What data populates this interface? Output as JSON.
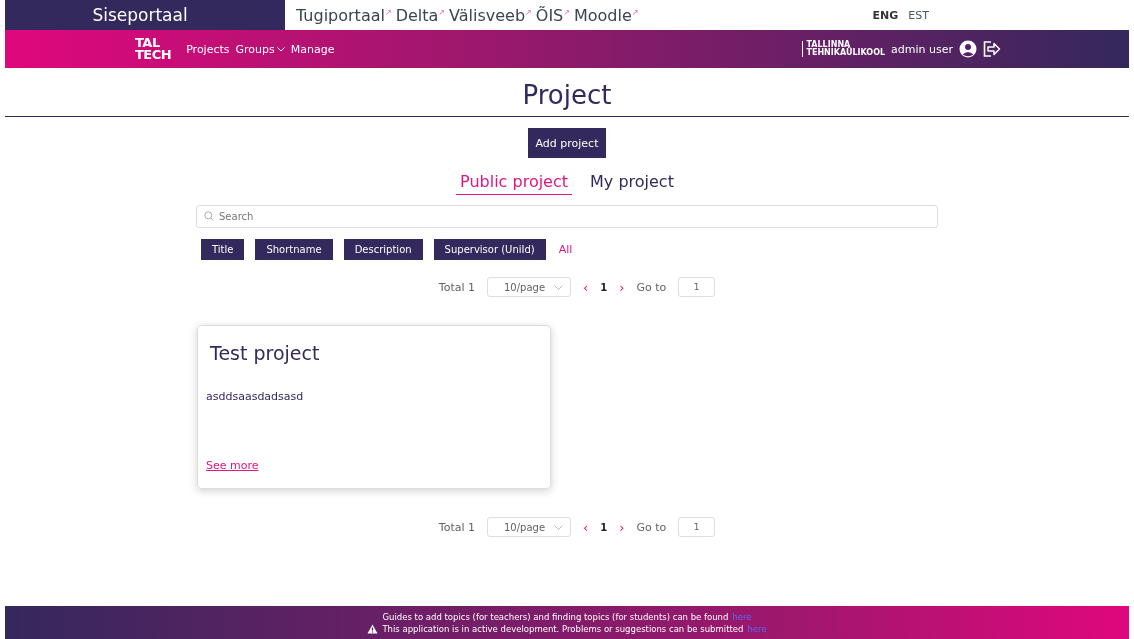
{
  "top_bar": {
    "portal_title": "Siseportaal",
    "links": [
      {
        "label": "Tugiportaal",
        "arrow": "↗"
      },
      {
        "label": "Delta",
        "arrow": "↗"
      },
      {
        "label": "Välisveeb",
        "arrow": "↗"
      },
      {
        "label": "ÕIS",
        "arrow": "↗"
      },
      {
        "label": "Moodle",
        "arrow": "↗"
      }
    ],
    "languages": [
      {
        "label": "ENG",
        "selected": true
      },
      {
        "label": "EST",
        "selected": false
      }
    ]
  },
  "nav": {
    "logo": [
      "TAL",
      "TECH"
    ],
    "items": [
      {
        "label": "Projects",
        "kind": "link"
      },
      {
        "label": "Groups",
        "kind": "dropdown"
      },
      {
        "label": "Manage",
        "kind": "link"
      }
    ],
    "university": [
      "TALLINNA",
      "TEHNIKAÜLIKOOL"
    ],
    "user": "admin user"
  },
  "page_title": "Project",
  "add_button": "Add project",
  "tabs": [
    {
      "label": "Public project",
      "selected": true
    },
    {
      "label": "My project",
      "selected": false
    }
  ],
  "search": {
    "placeholder": "Search"
  },
  "filters": [
    {
      "label": "Title",
      "kind": "button"
    },
    {
      "label": "Shortname",
      "kind": "button"
    },
    {
      "label": "Description",
      "kind": "button"
    },
    {
      "label": "Supervisor (UniId)",
      "kind": "button"
    },
    {
      "label": "All",
      "kind": "link"
    }
  ],
  "pagination_top": {
    "total": "Total 1",
    "page_size": "10/page",
    "prev": "‹",
    "pages": [
      {
        "label": "1",
        "selected": true
      }
    ],
    "next": "›",
    "goto_label": "Go to",
    "goto_value": "1"
  },
  "projects": [
    {
      "title": "Test project",
      "description": "asddsaasdadsasd",
      "link": "See more"
    }
  ],
  "pagination_bottom": {
    "total": "Total 1",
    "page_size": "10/page",
    "prev": "‹",
    "pages": [
      {
        "label": "1",
        "selected": true
      }
    ],
    "next": "›",
    "goto_label": "Go to",
    "goto_value": "1"
  },
  "footer": [
    {
      "text": "Guides to add topics (for teachers) and finding topics (for students) can be found",
      "link": "here",
      "warning": false
    },
    {
      "text": "This application is in active development. Problems or suggestions can be submitted",
      "link": "here",
      "warning": true
    }
  ]
}
